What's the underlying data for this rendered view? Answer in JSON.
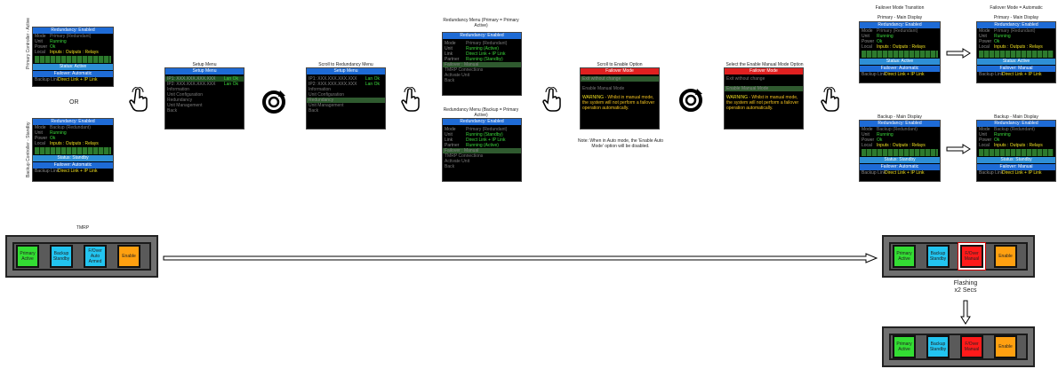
{
  "left": {
    "primary_label": "Primary Controller - Active",
    "backup_label": "Backup Controller - Standby",
    "or": "OR",
    "primary": {
      "title": "Redundancy: Enabled",
      "rows": [
        {
          "k": "Mode",
          "v": "Primary (Redundant)"
        },
        {
          "k": "Unit",
          "v": "Running"
        },
        {
          "k": "Power",
          "v": "Ok"
        }
      ],
      "local": "Local",
      "local_v": "Inputs : Outputs : Relays",
      "status": "Status: Active",
      "failover": "Failover: Automatic",
      "backup_link": "Backup Link",
      "link_v": "Direct Link + IP Link"
    },
    "backup": {
      "title": "Redundancy: Enabled",
      "rows": [
        {
          "k": "Mode",
          "v": "Backup (Redundant)"
        },
        {
          "k": "Unit",
          "v": "Running"
        },
        {
          "k": "Power",
          "v": "Ok"
        }
      ],
      "local": "Local",
      "local_v": "Inputs : Outputs : Relays",
      "status": "Status: Standby",
      "failover": "Failover: Automatic",
      "backup_link": "Backup Link",
      "link_v": "Direct Link + IP Link"
    }
  },
  "setup": {
    "caption": "Setup Menu",
    "title": "Setup Menu",
    "ip1": "IP1: XXX.XXX.XXX.XXX",
    "ip1s": "Lan Ok",
    "ip2": "IP2: XXX.XXX.XXX.XXX",
    "ip2s": "Lan Ok",
    "items": [
      "Information",
      "Unit Configuration",
      "Redundancy",
      "Unit Management",
      "Back"
    ]
  },
  "scroll": {
    "caption": "Scroll to Redundancy Menu",
    "title": "Setup Menu",
    "ip1": "IP1: XXX.XXX.XXX.XXX",
    "ip1s": "Lan Ok",
    "ip2": "IP2: XXX.XXX.XXX.XXX",
    "ip2s": "Lan Ok",
    "items": [
      "Information",
      "Unit Configuration",
      "Redundancy",
      "Unit Management",
      "Back"
    ]
  },
  "redPrimary": {
    "caption": "Redundancy Menu (Primary = Primary Active)",
    "title": "Redundancy: Enabled",
    "rows": [
      {
        "k": "Mode",
        "v": "Primary (Redundant)"
      },
      {
        "k": "Unit",
        "v": "Running (Active)"
      },
      {
        "k": "Link",
        "v": "Direct Link + IP Link"
      },
      {
        "k": "Partner",
        "v": "Running (Standby)"
      }
    ],
    "items": [
      "Failover : Manual",
      "TMRP Connections",
      "Activate Unit",
      "Back"
    ]
  },
  "redBackup": {
    "caption": "Redundancy Menu (Backup = Primary Active)",
    "title": "Redundancy: Enabled",
    "rows": [
      {
        "k": "Mode",
        "v": "Primary (Redundant)"
      },
      {
        "k": "Unit",
        "v": "Running (Standby)"
      },
      {
        "k": "Link",
        "v": "Direct Link + IP Link"
      },
      {
        "k": "Partner",
        "v": "Running (Active)"
      }
    ],
    "items": [
      "Failover : Manual",
      "TMRP Connections",
      "Activate Unit",
      "Back"
    ]
  },
  "enableOpt": {
    "caption": "Scroll to Enable Option",
    "title": "Failover Mode",
    "exit": "Exit without change",
    "enable": "Enable Manual Mode",
    "warning_label": "WARNING",
    "warning": " - Whilst in manual mode, the system will not perform a failover operation automatically.",
    "note": "Note: When in Auto mode, the 'Enable Auto Mode' option will be disabled."
  },
  "selectOpt": {
    "caption": "Select the Enable Manual Mode Option",
    "title": "Failover Mode",
    "exit": "Exit without change",
    "enable": "Enable Manual Mode",
    "warning_label": "WARNING",
    "warning": " - Whilst in manual mode, the system will not perform a failover operation automatically."
  },
  "transition": {
    "caption": "Failover Mode Transition",
    "caption2": "Failover Mode = Automatic",
    "primary_caption": "Primary - Main Display",
    "backup_caption": "Backup - Main Display",
    "primary_caption2": "Primary - Main Display",
    "backup_caption2": "Backup - Main Display",
    "pA": {
      "status": "Status: Active",
      "failover": "Failover: Automatic",
      "mode": "Primary (Redundant)"
    },
    "pM": {
      "status": "Status: Active",
      "failover": "Failover: Manual",
      "mode": "Primary (Redundant)"
    },
    "bA": {
      "status": "Status: Standby",
      "failover": "Failover: Automatic",
      "mode": "Backup (Redundant)"
    },
    "bM": {
      "status": "Status: Standby",
      "failover": "Failover: Manual",
      "mode": "Backup (Redundant)"
    },
    "title": "Redundancy: Enabled",
    "unit": "Running",
    "power": "Ok",
    "local_v": "Inputs : Outputs : Relays",
    "link_v": "Direct Link + IP Link"
  },
  "tmrp": {
    "caption": "TMRP",
    "buttons": [
      "Primary Active",
      "Backup Standby",
      "F/Over Auto Armed",
      "Enable"
    ],
    "buttons2": [
      "Primary Active",
      "Backup Standby",
      "F/Over Manual",
      "Enable"
    ],
    "buttons3": [
      "Primary Active",
      "Backup Standby",
      "F/Over Manual",
      "Enable"
    ],
    "flashing": "Flashing",
    "secs": "x2 Secs"
  }
}
